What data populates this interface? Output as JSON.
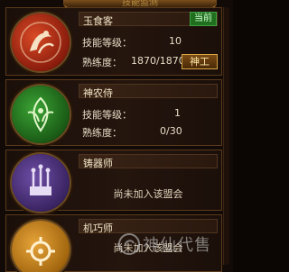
{
  "header": {
    "title": "技能监测"
  },
  "guilds": [
    {
      "name": "玉食客",
      "badge": "当前",
      "emblem": "chef-emblem-icon",
      "skill_label": "技能等级：",
      "skill_value": "10",
      "proficiency_label": "熟练度：",
      "proficiency_value": "1870/1870",
      "action_button": "神工",
      "accent": "#c23a1c"
    },
    {
      "name": "神农侍",
      "emblem": "herbalist-emblem-icon",
      "skill_label": "技能等级：",
      "skill_value": "1",
      "proficiency_label": "熟练度：",
      "proficiency_value": "0/30",
      "accent": "#2f8a2a"
    },
    {
      "name": "铸器师",
      "emblem": "forge-emblem-icon",
      "status": "尚未加入该盟会",
      "accent": "#5a3c86"
    },
    {
      "name": "机巧师",
      "emblem": "mechanist-emblem-icon",
      "status": "尚未加入该盟会",
      "accent": "#c8861c"
    }
  ],
  "watermark": {
    "text": "神仙代售"
  }
}
